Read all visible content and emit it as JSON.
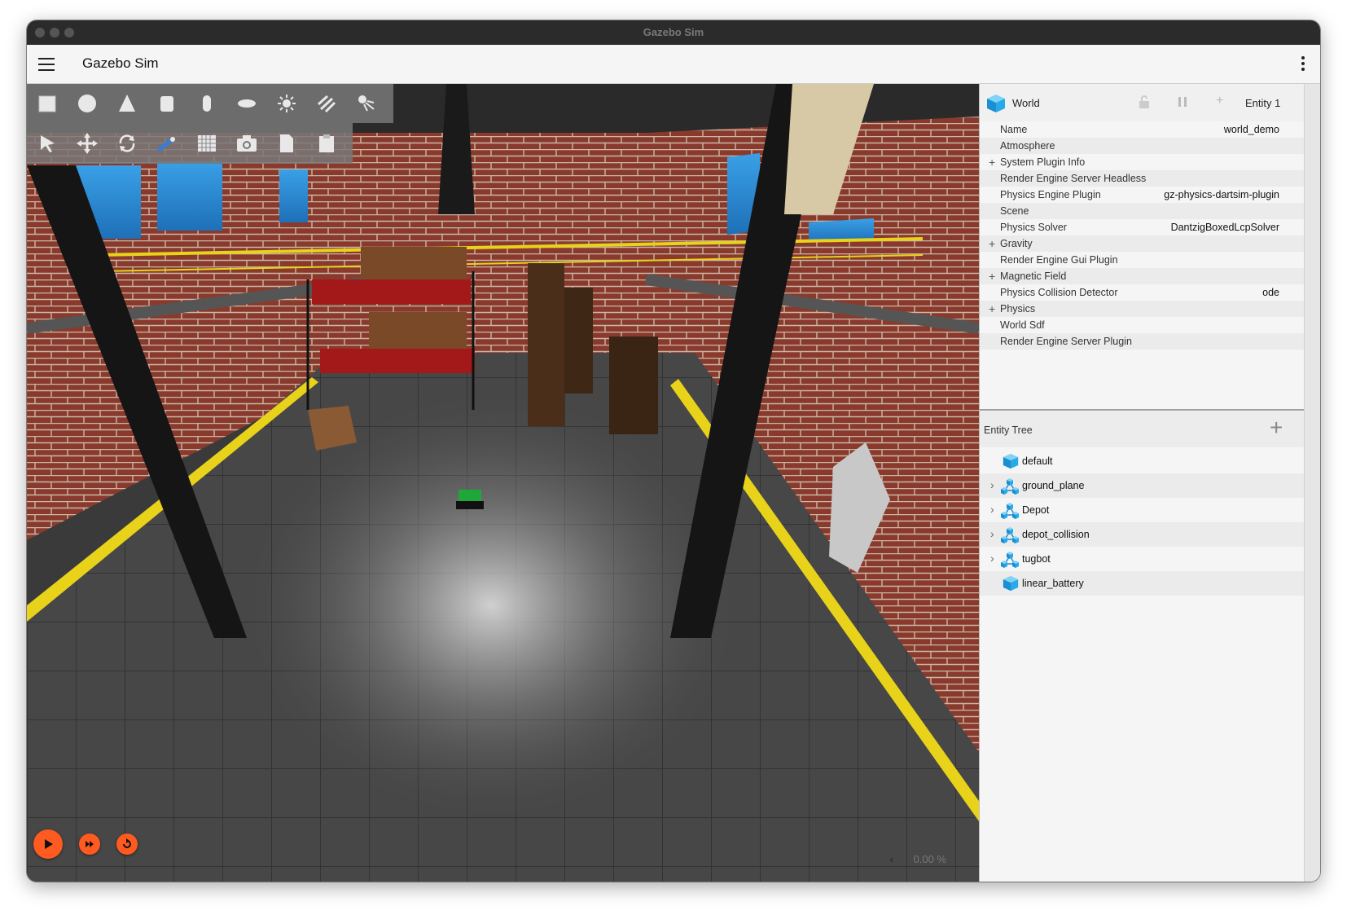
{
  "window": {
    "title": "Gazebo Sim"
  },
  "appbar": {
    "title": "Gazebo Sim"
  },
  "toolbar": {
    "shapes": [
      "box-icon",
      "sphere-icon",
      "cone-icon",
      "cylinder-icon",
      "capsule-icon",
      "ellipsoid-icon",
      "point-light-icon",
      "directional-light-icon",
      "spot-light-icon"
    ],
    "tools": [
      "select-icon",
      "translate-icon",
      "rotate-icon",
      "transform-control-icon",
      "grid-snap-icon",
      "screenshot-icon",
      "copy-icon",
      "paste-icon"
    ]
  },
  "controls": {
    "rtf": "0.00 %",
    "rtf_chevron": "‹"
  },
  "component_inspector": {
    "world_label": "World",
    "entity_label": "Entity 1",
    "rows": [
      {
        "label": "Name",
        "value": "world_demo",
        "expandable": false
      },
      {
        "label": "Atmosphere",
        "value": "",
        "expandable": false
      },
      {
        "label": "System Plugin Info",
        "value": "",
        "expandable": true
      },
      {
        "label": "Render Engine Server Headless",
        "value": "",
        "expandable": false
      },
      {
        "label": "Physics Engine Plugin",
        "value": "gz-physics-dartsim-plugin",
        "expandable": false
      },
      {
        "label": "Scene",
        "value": "",
        "expandable": false
      },
      {
        "label": "Physics Solver",
        "value": "DantzigBoxedLcpSolver",
        "expandable": false
      },
      {
        "label": "Gravity",
        "value": "",
        "expandable": true
      },
      {
        "label": "Render Engine Gui Plugin",
        "value": "",
        "expandable": false
      },
      {
        "label": "Magnetic Field",
        "value": "",
        "expandable": true
      },
      {
        "label": "Physics Collision Detector",
        "value": "ode",
        "expandable": false
      },
      {
        "label": "Physics",
        "value": "",
        "expandable": true
      },
      {
        "label": "World Sdf",
        "value": "",
        "expandable": false
      },
      {
        "label": "Render Engine Server Plugin",
        "value": "",
        "expandable": false
      }
    ]
  },
  "entity_tree": {
    "title": "Entity Tree",
    "add_label": "+",
    "items": [
      {
        "name": "default",
        "type": "world",
        "expandable": false
      },
      {
        "name": "ground_plane",
        "type": "model",
        "expandable": true
      },
      {
        "name": "Depot",
        "type": "model",
        "expandable": true
      },
      {
        "name": "depot_collision",
        "type": "model",
        "expandable": true
      },
      {
        "name": "tugbot",
        "type": "model",
        "expandable": true
      },
      {
        "name": "linear_battery",
        "type": "light",
        "expandable": false
      }
    ]
  },
  "colors": {
    "accent": "#ff5a1f",
    "brick": "#8a3a2c",
    "floor": "#454545",
    "stripe": "#e8d21a"
  }
}
